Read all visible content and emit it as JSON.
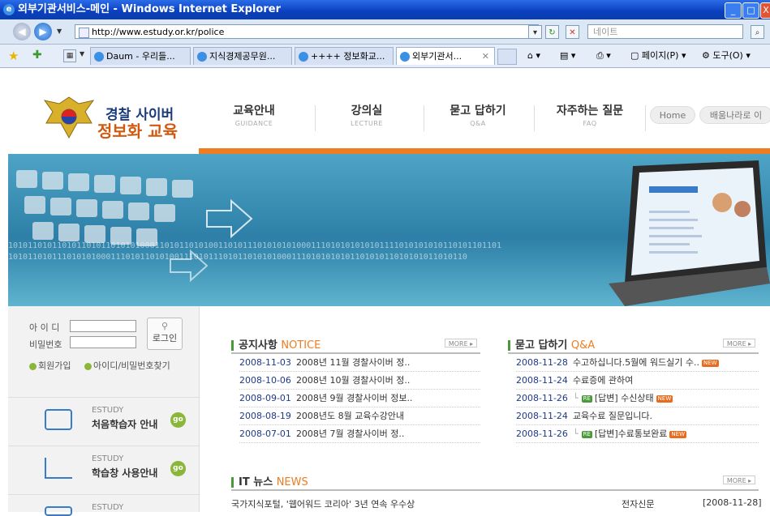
{
  "window": {
    "title": "외부기관서비스-메인 - Windows Internet Explorer",
    "url": "http://www.estudy.or.kr/police",
    "search_placeholder": "네이트"
  },
  "tabs": [
    {
      "label": "Daum - 우리들..."
    },
    {
      "label": "지식경제공무원..."
    },
    {
      "label": "++++ 정보화교..."
    },
    {
      "label": "외부기관서..."
    }
  ],
  "toolbar": {
    "page_label": "페이지(P)",
    "tools_label": "도구(O)"
  },
  "site": {
    "logo_line1": "경찰 사이버",
    "logo_line2": "정보화 교육",
    "menu": [
      {
        "ko": "교육안내",
        "en": "GUIDANCE"
      },
      {
        "ko": "강의실",
        "en": "LECTURE"
      },
      {
        "ko": "묻고 답하기",
        "en": "Q&A"
      },
      {
        "ko": "자주하는 질문",
        "en": "FAQ"
      }
    ],
    "home_label": "Home",
    "partner_label": "배움나라로 이"
  },
  "banner": {
    "binary_1": "10101101011010110101101010100011010110101001101011101010101000111010101010101111010101010110101101101",
    "binary_2": "1010110101110101010001110101101010011101011101011010101000111010101010110101011010101011010110"
  },
  "login": {
    "id_label": "아 이 디",
    "pw_label": "비밀번호",
    "button_label": "로그인",
    "join_label": "회원가입",
    "find_label": "아이디/비밀번호찾기"
  },
  "guides": [
    {
      "en": "ESTUDY",
      "ko": "처음학습자 안내",
      "go": "go"
    },
    {
      "en": "ESTUDY",
      "ko": "학습창 사용안내",
      "go": "go"
    },
    {
      "en": "ESTUDY",
      "ko": "",
      "go": ""
    }
  ],
  "notice": {
    "title_ko": "공지사항",
    "title_en": "NOTICE",
    "more": "MORE ▸",
    "items": [
      {
        "date": "2008-11-03",
        "text": "2008년 11월 경찰사이버 정.."
      },
      {
        "date": "2008-10-06",
        "text": "2008년 10월 경찰사이버 정.."
      },
      {
        "date": "2008-09-01",
        "text": "2008년 9월 경찰사이버 정보.."
      },
      {
        "date": "2008-08-19",
        "text": "2008년도 8월 교육수강안내"
      },
      {
        "date": "2008-07-01",
        "text": "2008년 7월 경찰사이버 정.."
      }
    ]
  },
  "qna": {
    "title_ko": "묻고 답하기",
    "title_en": "Q&A",
    "more": "MORE ▸",
    "items": [
      {
        "date": "2008-11-28",
        "text": "수고하십니다.5월에 워드실기 수..",
        "re": "",
        "new": "NEW"
      },
      {
        "date": "2008-11-24",
        "text": "수료증에 관하여",
        "re": "",
        "new": ""
      },
      {
        "date": "2008-11-26",
        "text": "[답변] 수신상태",
        "re": "RE",
        "new": "NEW"
      },
      {
        "date": "2008-11-24",
        "text": "교육수료 질문입니다.",
        "re": "",
        "new": ""
      },
      {
        "date": "2008-11-26",
        "text": "[답변]수료통보완료",
        "re": "RE",
        "new": "NEW"
      }
    ]
  },
  "news": {
    "title_ko": "IT 뉴스",
    "title_en": "NEWS",
    "more": "MORE ▸",
    "items": [
      {
        "text": "국가지식포털, '웹어워드 코리아' 3년 연속 우수상",
        "source": "전자신문",
        "date": "[2008-11-28]"
      }
    ]
  }
}
